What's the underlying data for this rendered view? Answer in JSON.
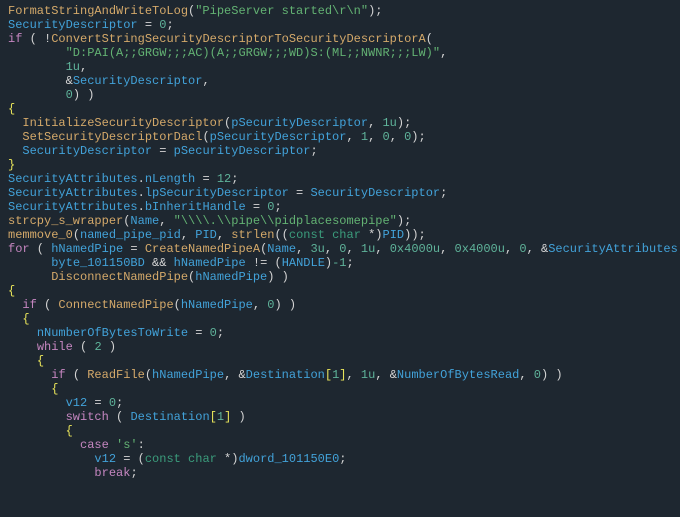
{
  "code": {
    "t": [
      "FormatStringAndWriteToLog",
      "\"PipeServer started\\r\\n\"",
      "SecurityDescriptor",
      "0",
      "if",
      "ConvertStringSecurityDescriptorToSecurityDescriptorA",
      "\"D:PAI(A;;GRGW;;;AC)(A;;GRGW;;;WD)S:(ML;;NWNR;;;LW)\"",
      "1u",
      "SecurityDescriptor",
      "0",
      "InitializeSecurityDescriptor",
      "pSecurityDescriptor",
      "1u",
      "SetSecurityDescriptorDacl",
      "pSecurityDescriptor",
      "1",
      "0",
      "0",
      "SecurityDescriptor",
      "pSecurityDescriptor",
      "SecurityAttributes",
      "nLength",
      "12",
      "SecurityAttributes",
      "lpSecurityDescriptor",
      "SecurityDescriptor",
      "SecurityAttributes",
      "bInheritHandle",
      "0",
      "strcpy_s_wrapper",
      "Name",
      "\"\\\\\\\\.\\\\pipe\\\\pidplacesomepipe\"",
      "memmove_0",
      "named_pipe_pid",
      "PID",
      "strlen",
      "const char",
      "PID",
      "for",
      "hNamedPipe",
      "CreateNamedPipeA",
      "Name",
      "3u",
      "0",
      "1u",
      "0x4000u",
      "0x4000u",
      "0",
      "SecurityAttributes",
      "byte_101150BD",
      "hNamedPipe",
      "HANDLE",
      "-1",
      "DisconnectNamedPipe",
      "hNamedPipe",
      "if",
      "ConnectNamedPipe",
      "hNamedPipe",
      "0",
      "nNumberOfBytesToWrite",
      "0",
      "while",
      "2",
      "if",
      "ReadFile",
      "hNamedPipe",
      "Destination",
      "1",
      "1u",
      "NumberOfBytesRead",
      "0",
      "v12",
      "0",
      "switch",
      "Destination",
      "1",
      "case",
      "'s'",
      "v12",
      "const char",
      "dword_101150E0",
      "break"
    ]
  }
}
